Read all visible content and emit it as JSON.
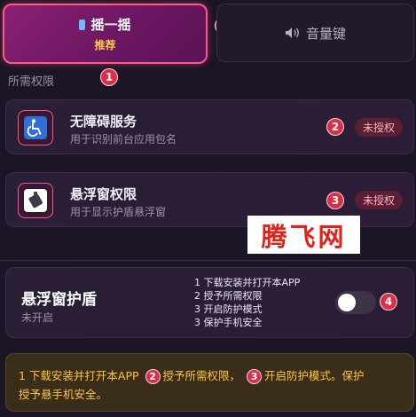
{
  "tabs": {
    "shake": {
      "label": "摇一摇",
      "sub": "推荐"
    },
    "volume": {
      "label": "音量键"
    }
  },
  "badges": {
    "b1": "1",
    "b2": "2",
    "b3": "3",
    "b4": "4"
  },
  "permissions": {
    "section_label": "所需权限",
    "accessibility": {
      "title": "无障碍服务",
      "desc": "用于识别前台应用包名",
      "status": "未授权"
    },
    "overlay": {
      "title": "悬浮窗权限",
      "desc": "用于显示护盾悬浮窗",
      "status": "未授权"
    }
  },
  "watermark": "腾飞网",
  "shield": {
    "title": "悬浮窗护盾",
    "status": "未开启",
    "steps": [
      "1 下载安装并打开本APP",
      "2 授予所需权限",
      "3 开启防护模式",
      "3 保护手机安全"
    ],
    "toggle_on": false
  },
  "info": {
    "part1": "1 下载安装并打开本APP",
    "part2": "授予所需权限，",
    "part3": "开启防护模式。保护",
    "part4": "授予悬手机安全。"
  },
  "colors": {
    "accent": "#ff5a83",
    "badge": "#d9304a",
    "info_text": "#ffc43d"
  }
}
